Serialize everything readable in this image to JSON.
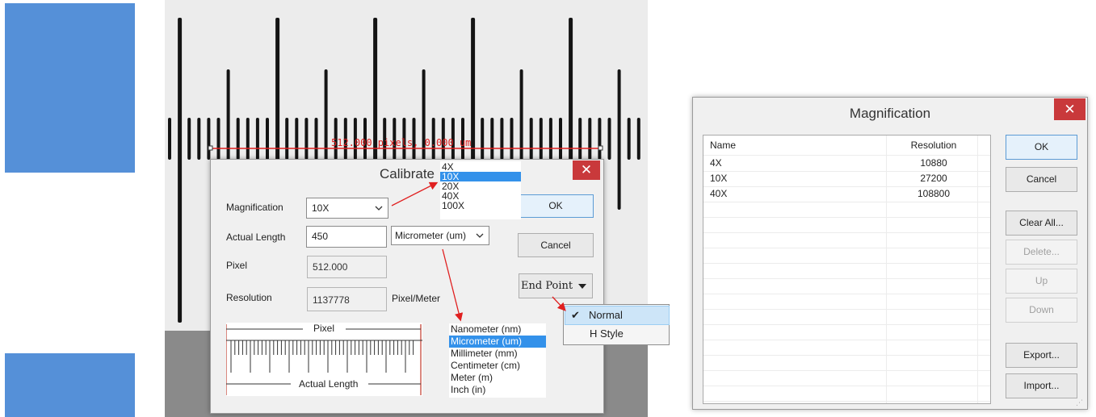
{
  "calibrate": {
    "title": "Calibrate",
    "close": "✕",
    "magnification_label": "Magnification",
    "magnification_value": "10X",
    "magnification_options": [
      "4X",
      "10X",
      "20X",
      "40X",
      "100X"
    ],
    "magnification_selected_index": 1,
    "actual_length_label": "Actual Length",
    "actual_length_value": "450",
    "unit_value": "Micrometer (um)",
    "unit_options": [
      "Nanometer (nm)",
      "Micrometer (um)",
      "Millimeter (mm)",
      "Centimeter (cm)",
      "Meter (m)",
      "Inch (in)"
    ],
    "unit_selected_index": 1,
    "pixel_label": "Pixel",
    "pixel_value": "512.000",
    "resolution_label": "Resolution",
    "resolution_value": "1137778",
    "resolution_unit": "Pixel/Meter",
    "ok": "OK",
    "cancel": "Cancel",
    "end_point": "End Point",
    "end_point_options": [
      "Normal",
      "H Style"
    ],
    "end_point_selected_index": 0,
    "diagram_pixel": "Pixel",
    "diagram_actual": "Actual Length"
  },
  "camera": {
    "measure_text": "512.000 pixels, 0.000 um"
  },
  "magnification_dialog": {
    "title": "Magnification",
    "close": "✕",
    "columns": [
      "Name",
      "Resolution"
    ],
    "rows": [
      {
        "name": "4X",
        "resolution": "10880"
      },
      {
        "name": "10X",
        "resolution": "27200"
      },
      {
        "name": "40X",
        "resolution": "108800"
      }
    ],
    "buttons": {
      "ok": "OK",
      "cancel": "Cancel",
      "clear_all": "Clear All...",
      "delete": "Delete...",
      "up": "Up",
      "down": "Down",
      "export": "Export...",
      "import": "Import..."
    }
  },
  "colors": {
    "accent_blue": "#5590d8",
    "selection": "#3391ea",
    "close_red": "#c9393b",
    "annotation_red": "#e02020"
  }
}
